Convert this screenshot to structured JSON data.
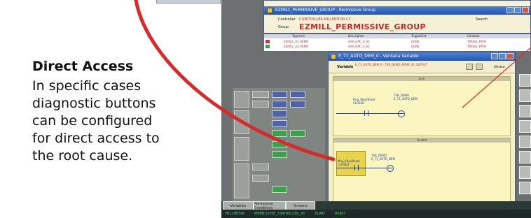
{
  "callout": {
    "title": "Direct Access",
    "lines": [
      "In specific cases",
      "diagnostic buttons",
      "can be configured",
      "for direct access to",
      "the root cause."
    ]
  },
  "window1": {
    "title": "EZMILL_PERMISSIVE_GROUP - Permissive Group",
    "controller_label": "Controller",
    "controller_value": "CONTROLLER MILLMOTOR CC",
    "group_label": "Group",
    "group_value": "EZMILL_PERMISSIVE_GROUP",
    "search_label": "Search"
  },
  "table1": {
    "headers": [
      "Tagname",
      "Description",
      "TrippedCnt",
      "Contacts"
    ],
    "rows": [
      [
        "EZMILL_A1_PERM",
        "AAA_HPC_A_A4",
        "DONE",
        "TRAVEL_PATH"
      ],
      [
        "EZMILL_A2_PERM",
        "AAA_HPC_A_A2",
        "DONE",
        "TRAVEL_PATH"
      ]
    ]
  },
  "window2": {
    "title": "E_71_AUTO_DEM_0 - Ventana Variable",
    "variable_label": "Variable",
    "variable_value": "E_71_AUTO_DEM_0 : TSR_DEMO_PERM_01_OUTPUT",
    "window_label": "Window",
    "panel_top_title": "Live",
    "panel_bottom_title": "Faulted"
  },
  "status_bar": {
    "items": [
      "MILLMOTOR",
      "PERMISSIVE_CONTROLLER_01",
      "PLANT",
      "READY"
    ]
  },
  "bottom_buttons": [
    "Variables",
    "Permissive Conditions",
    "Screens"
  ],
  "colors": {
    "accent_red": "#d72b2b",
    "title_blue": "#2454b0",
    "panel_yellow": "#f5f0bf"
  }
}
